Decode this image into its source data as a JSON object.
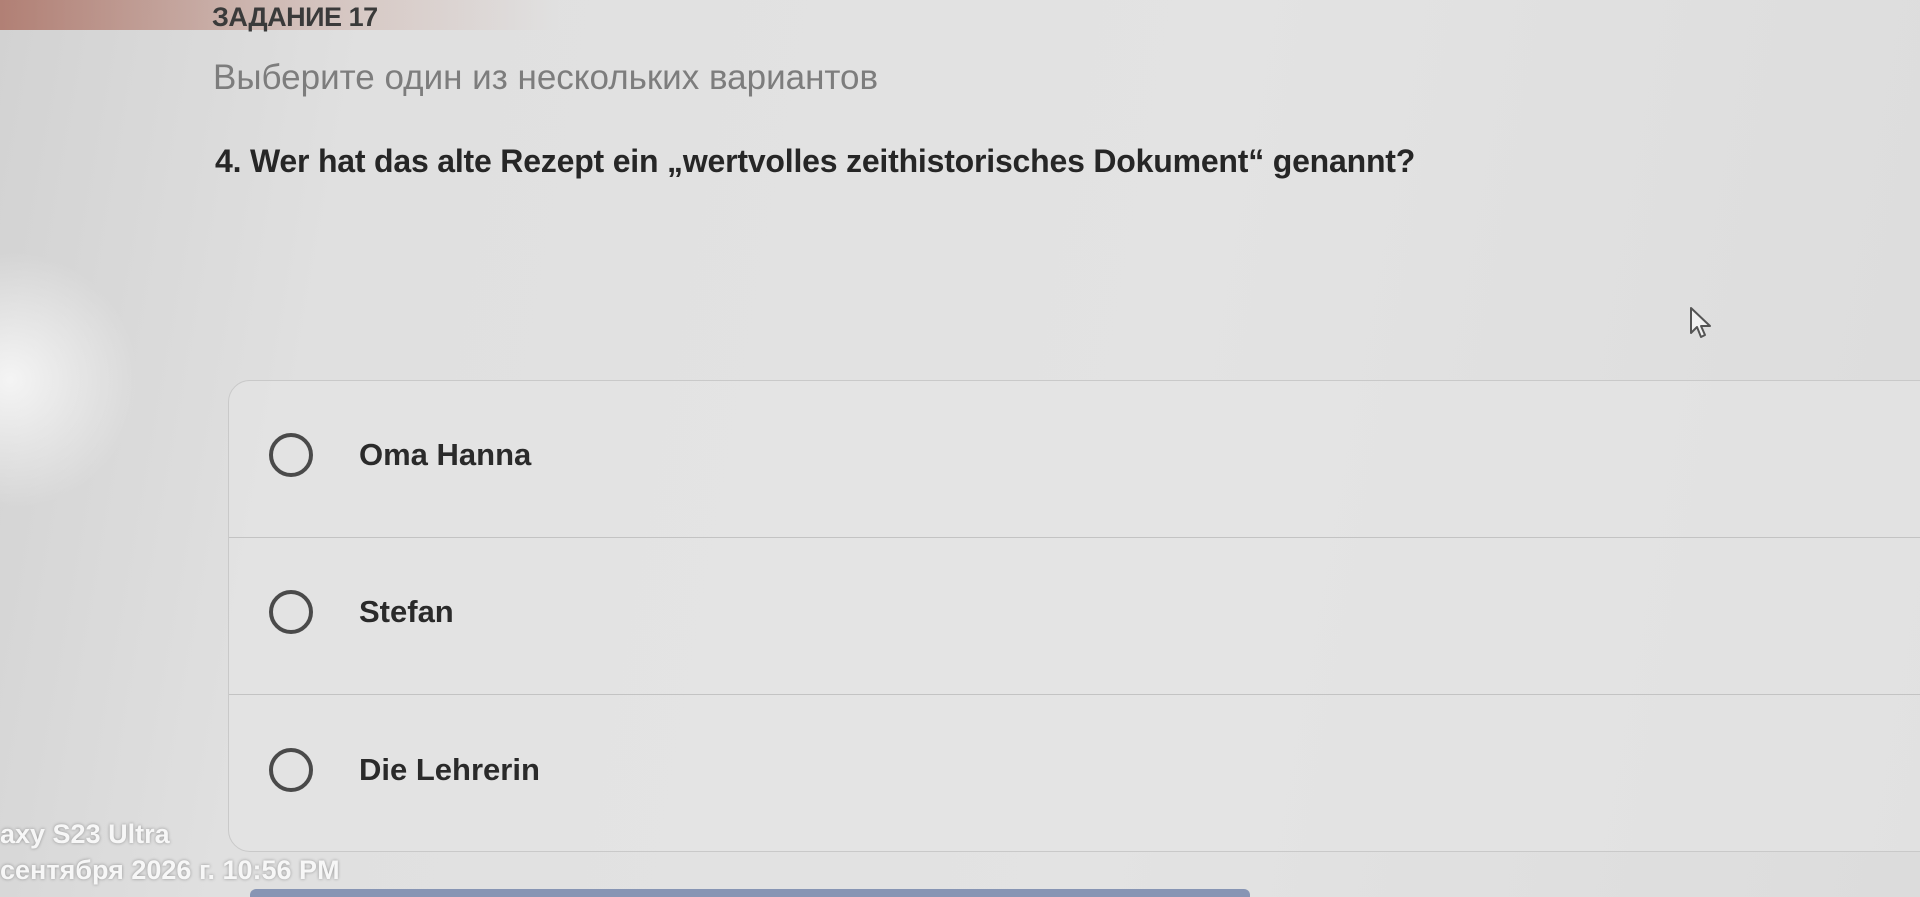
{
  "task": {
    "label": "ЗАДАНИЕ 17",
    "instruction": "Выберите один из нескольких вариантов",
    "question": "4. Wer hat das alte Rezept ein „wertvolles zeithistorisches Dokument“ genannt?"
  },
  "options": [
    {
      "label": "Oma Hanna",
      "selected": false
    },
    {
      "label": "Stefan",
      "selected": false
    },
    {
      "label": "Die Lehrerin",
      "selected": false
    }
  ],
  "cursor": {
    "icon": "mouse-pointer-icon"
  },
  "watermark": {
    "device": "axy S23 Ultra",
    "timestamp": "сентября 2026 г. 10:56 PM"
  },
  "colors": {
    "text_primary": "#262626",
    "text_secondary": "#7d7d7d",
    "radio_border": "#4a4a4a"
  }
}
